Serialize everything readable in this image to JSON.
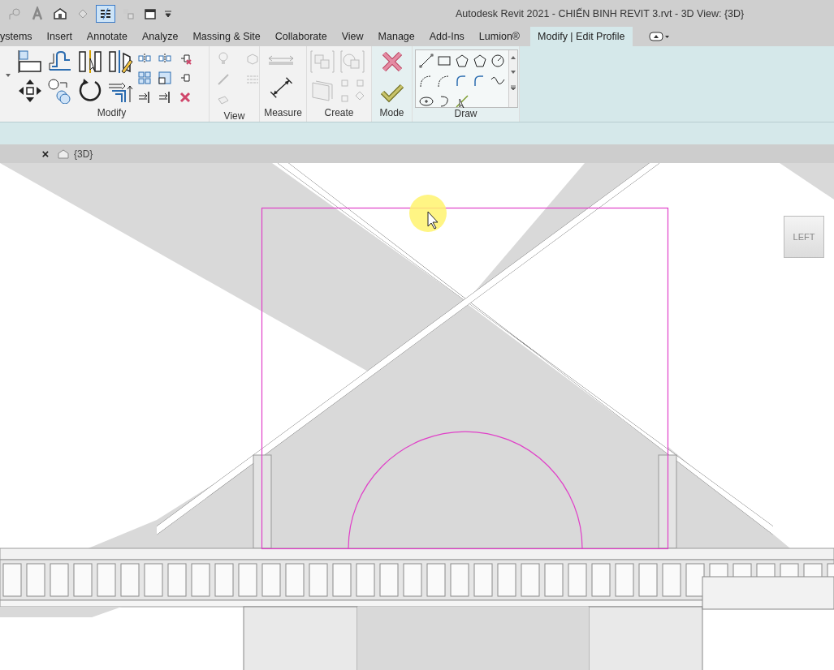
{
  "window": {
    "title": "Autodesk Revit 2021 - CHIẾN BINH REVIT 3.rvt - 3D View: {3D}"
  },
  "quick_access": [
    {
      "on": false
    },
    {
      "on": false
    },
    {
      "on": false
    },
    {
      "on": false
    },
    {
      "on": true
    },
    {
      "on": false
    },
    {
      "on": false
    }
  ],
  "tabs": [
    {
      "label": "ystems",
      "selected": false
    },
    {
      "label": "Insert",
      "selected": false
    },
    {
      "label": "Annotate",
      "selected": false
    },
    {
      "label": "Analyze",
      "selected": false
    },
    {
      "label": "Massing & Site",
      "selected": false
    },
    {
      "label": "Collaborate",
      "selected": false
    },
    {
      "label": "View",
      "selected": false
    },
    {
      "label": "Manage",
      "selected": false
    },
    {
      "label": "Add-Ins",
      "selected": false
    },
    {
      "label": "Lumion®",
      "selected": false
    },
    {
      "label": "Modify | Edit Profile",
      "selected": true
    }
  ],
  "ribbon_panels": [
    {
      "label": "Modify",
      "kind": "plain"
    },
    {
      "label": "View",
      "kind": "plain"
    },
    {
      "label": "Measure",
      "kind": "plain"
    },
    {
      "label": "Create",
      "kind": "plain"
    },
    {
      "label": "Mode",
      "kind": "context"
    },
    {
      "label": "Draw",
      "kind": "context"
    }
  ],
  "view_tabs": {
    "close_glyph": "×",
    "tab": "{3D}"
  },
  "view_cube": {
    "face": "LEFT"
  }
}
